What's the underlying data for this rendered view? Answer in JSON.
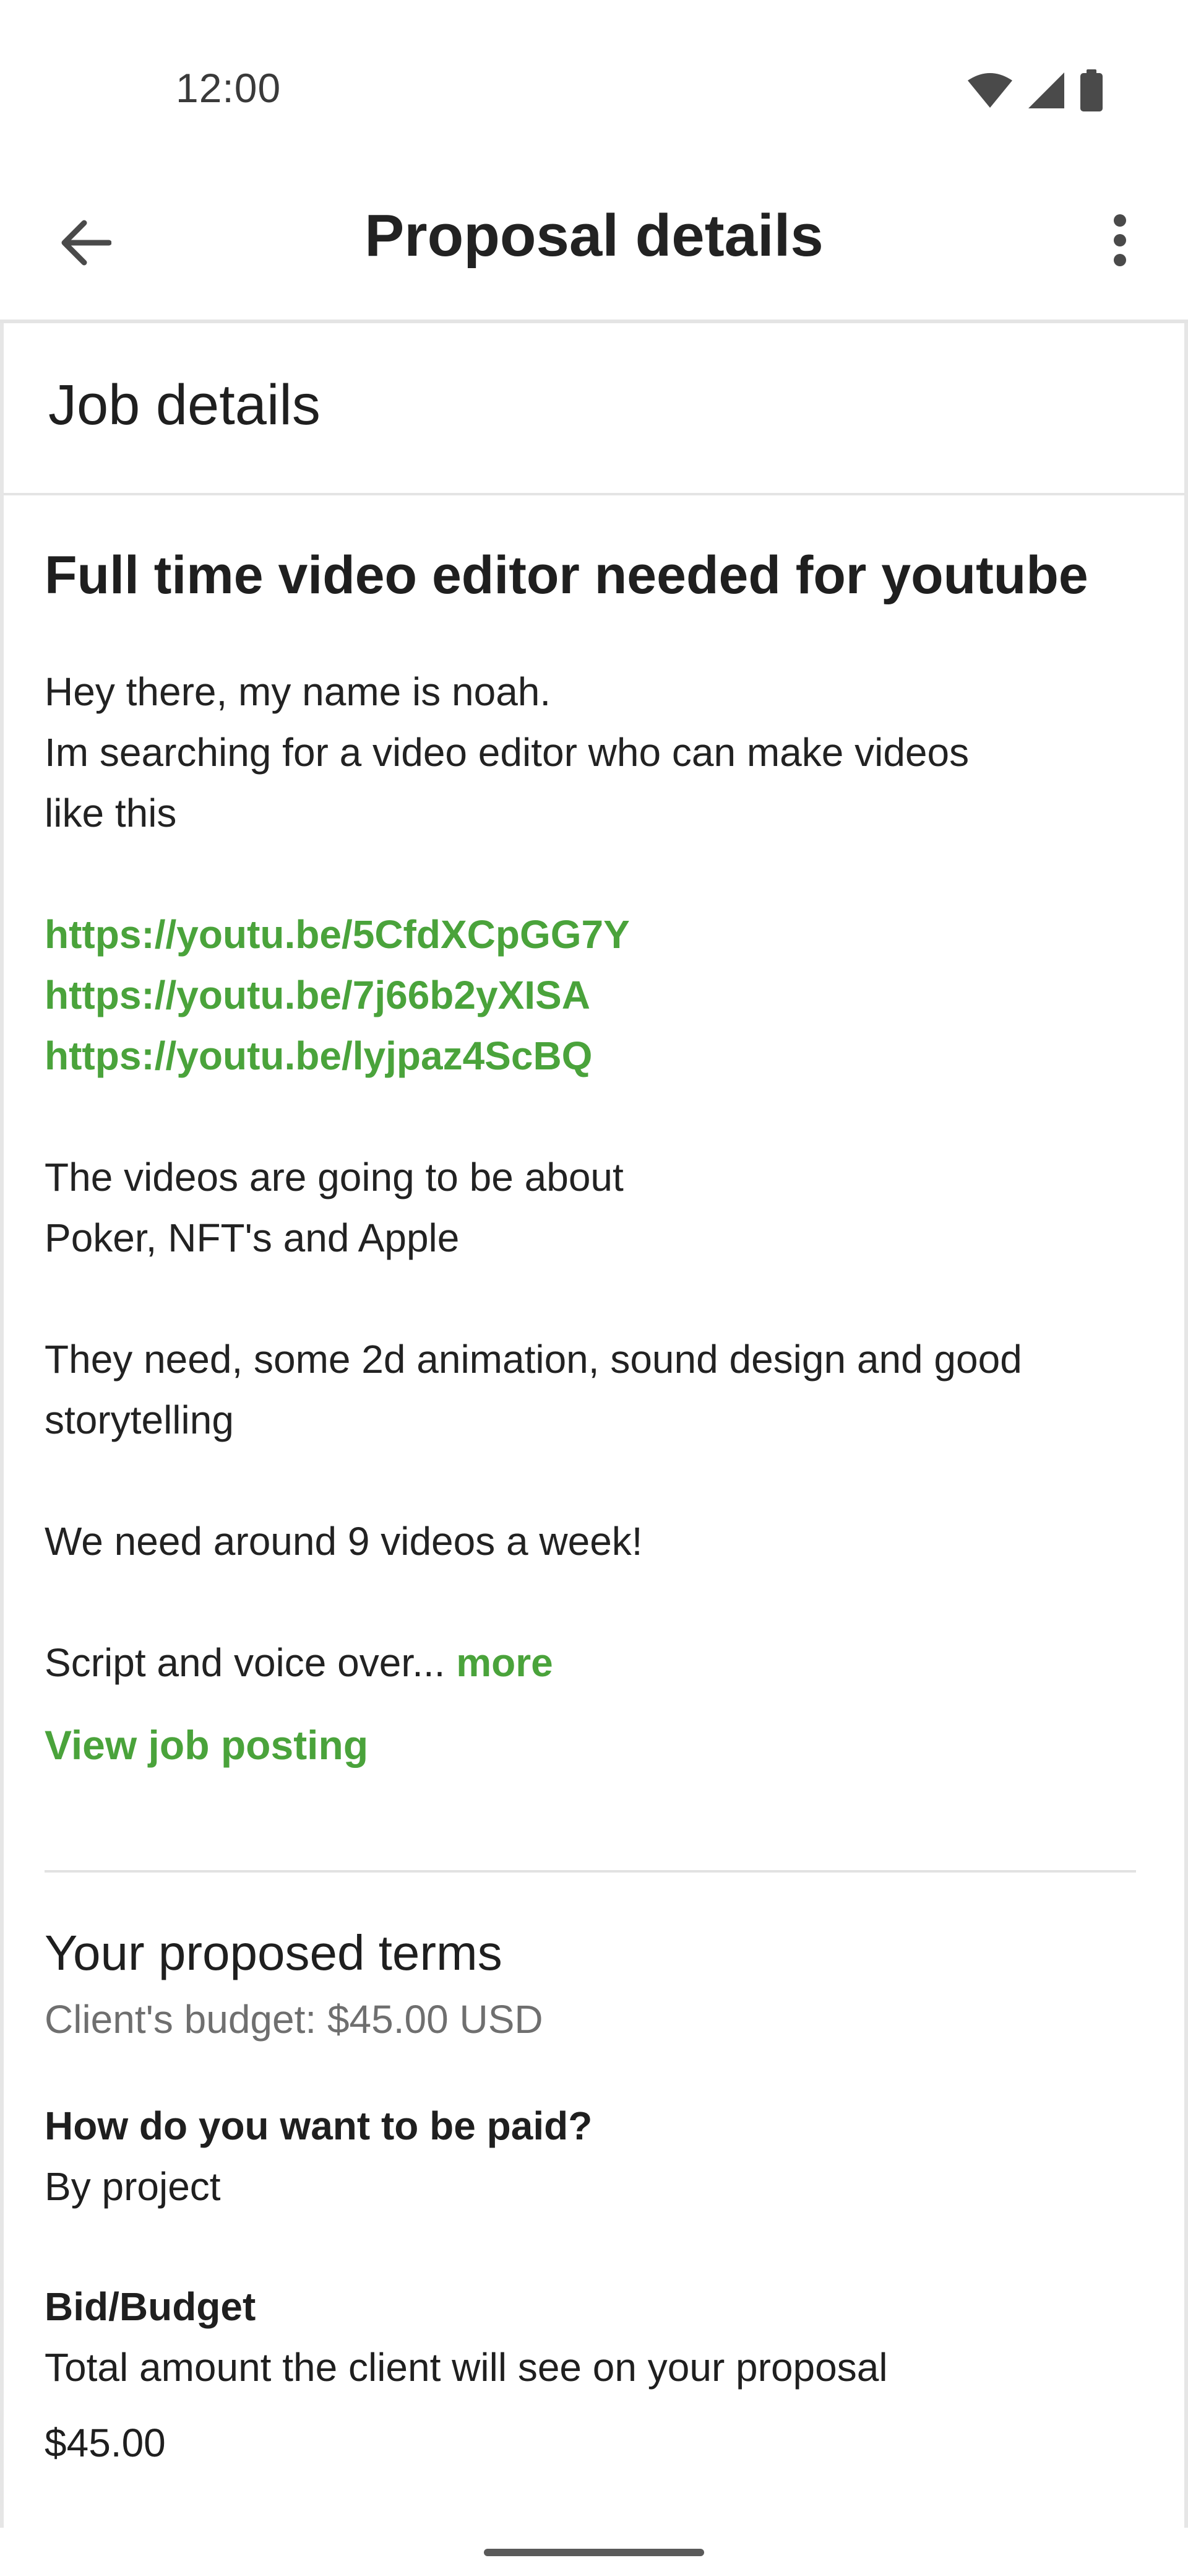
{
  "status_bar": {
    "time": "12:00",
    "icons": [
      "wifi-icon",
      "signal-icon",
      "battery-icon"
    ]
  },
  "app_bar": {
    "title": "Proposal details",
    "back_icon": "arrow-back-icon",
    "menu_icon": "more-vert-icon"
  },
  "job_details": {
    "section_title": "Job details",
    "title": "Full time video editor needed for youtube",
    "description_lines": [
      "Hey there, my name is noah.",
      "Im searching for a video editor who can make videos",
      "like this",
      "The videos are going to be about",
      "Poker, NFT's and Apple",
      "They need, some 2d animation, sound design and good",
      "storytelling",
      "We need around 9 videos a week!",
      "Script and voice over..."
    ],
    "links": [
      "https://youtu.be/5CfdXCpGG7Y",
      "https://youtu.be/7j66b2yXISA",
      "https://youtu.be/lyjpaz4ScBQ"
    ],
    "more_label": "more",
    "view_posting_label": "View job posting"
  },
  "terms": {
    "title": "Your proposed terms",
    "budget": "Client's budget: $45.00 USD",
    "payment_question": "How do you want to be paid?",
    "payment_answer": "By project",
    "bid_label": "Bid/Budget",
    "bid_description": "Total amount the client will see on your proposal",
    "bid_value": "$45.00"
  },
  "colors": {
    "accent_green": "#4aa33b",
    "text_primary": "#1f1f1f",
    "text_secondary": "#6f6f6f",
    "divider": "#e2e2e2"
  }
}
